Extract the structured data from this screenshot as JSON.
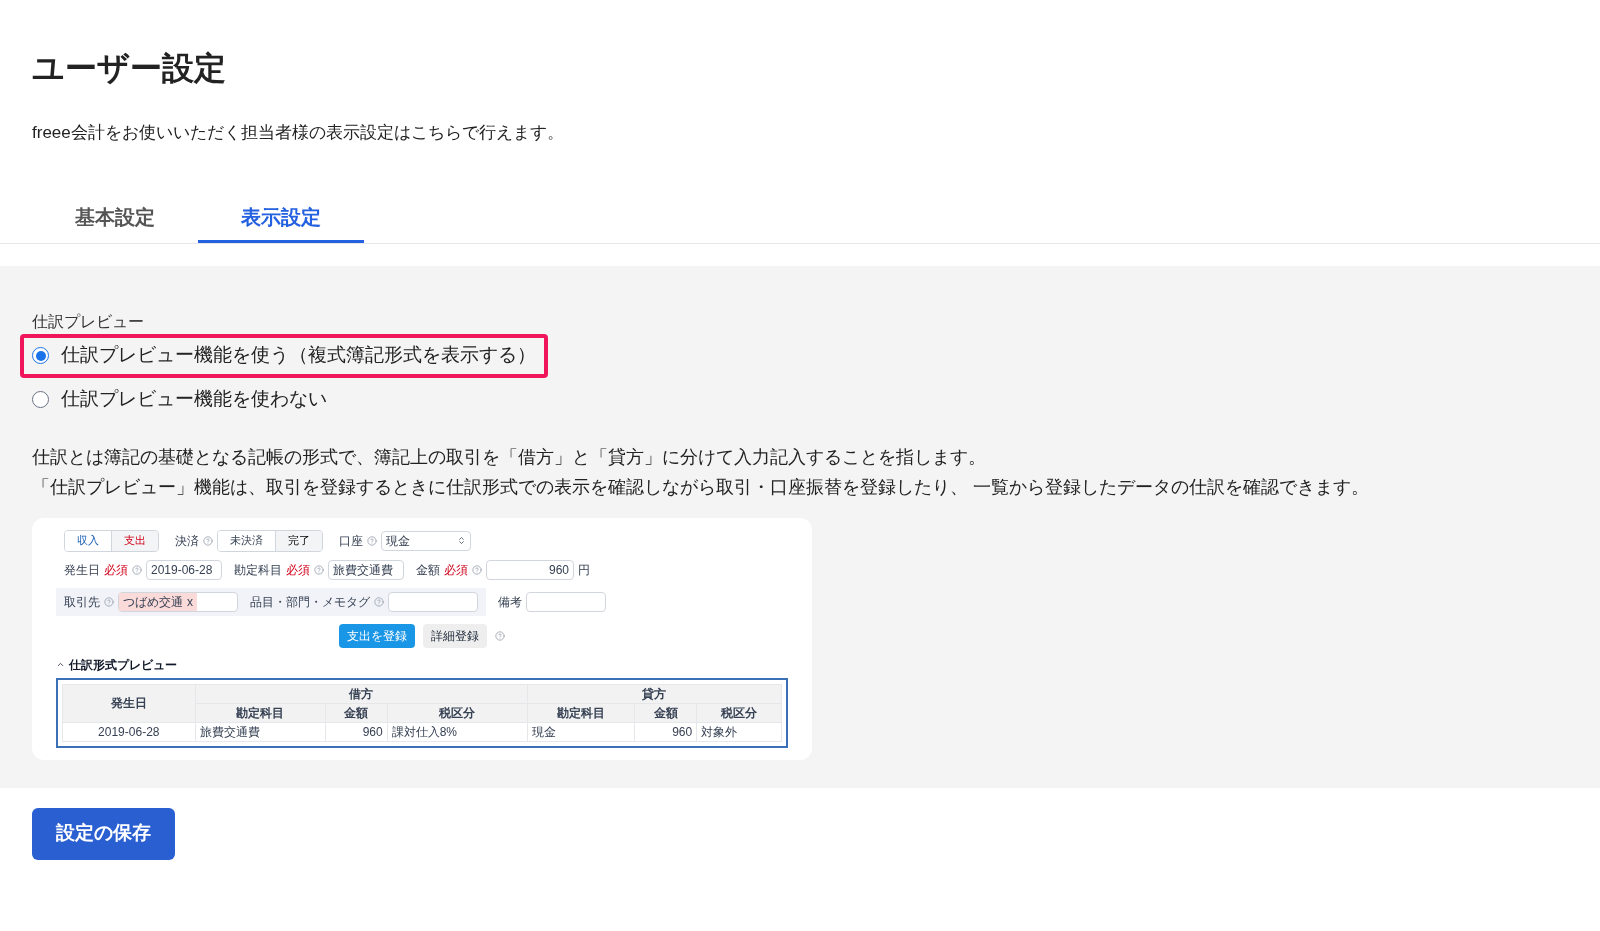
{
  "title": "ユーザー設定",
  "description": "freee会計をお使いいただく担当者様の表示設定はこちらで行えます。",
  "tabs": [
    {
      "label": "基本設定",
      "selected": false
    },
    {
      "label": "表示設定",
      "selected": true
    }
  ],
  "section": {
    "label": "仕訳プレビュー",
    "options": [
      {
        "label": "仕訳プレビュー機能を使う（複式簿記形式を表示する）",
        "selected": true,
        "highlighted": true
      },
      {
        "label": "仕訳プレビュー機能を使わない",
        "selected": false,
        "highlighted": false
      }
    ]
  },
  "explanation": [
    "仕訳とは簿記の基礎となる記帳の形式で、簿記上の取引を「借方」と「貸方」に分けて入力記入することを指します。",
    "「仕訳プレビュー」機能は、取引を登録するときに仕訳形式での表示を確認しながら取引・口座振替を登録したり、 一覧から登録したデータの仕訳を確認できます。"
  ],
  "preview": {
    "type_toggle": [
      {
        "label": "収入",
        "selected": false
      },
      {
        "label": "支出",
        "selected": true
      }
    ],
    "settlement": {
      "label": "決済",
      "options": [
        {
          "label": "未決済",
          "selected": false
        },
        {
          "label": "完了",
          "selected": true
        }
      ]
    },
    "account": {
      "label": "口座",
      "value": "現金"
    },
    "fields": [
      {
        "label": "発生日",
        "required": "必須",
        "value": "2019-06-28",
        "kind": "text"
      },
      {
        "label": "勘定科目",
        "required": "必須",
        "value": "旅費交通費",
        "kind": "text"
      },
      {
        "label": "金額",
        "required": "必須",
        "value": "960",
        "kind": "amount",
        "unit": "円"
      }
    ],
    "partner": {
      "label": "取引先",
      "tag": "つばめ交通",
      "remove": "x"
    },
    "tags_field": {
      "label": "品目・部門・メモタグ"
    },
    "note_field": {
      "label": "備考"
    },
    "buttons": [
      {
        "label": "支出を登録",
        "kind": "primary"
      },
      {
        "label": "詳細登録",
        "kind": "secondary"
      }
    ],
    "journal": {
      "caption": "仕訳形式プレビュー",
      "date_header": "発生日",
      "groups": [
        "借方",
        "貸方"
      ],
      "sub_headers": [
        "勘定科目",
        "金額",
        "税区分",
        "勘定科目",
        "金額",
        "税区分"
      ],
      "row": {
        "date": "2019-06-28",
        "cells": [
          "旅費交通費",
          "960",
          "課対仕入8%",
          "現金",
          "960",
          "対象外"
        ]
      }
    }
  },
  "save_button": "設定の保存"
}
